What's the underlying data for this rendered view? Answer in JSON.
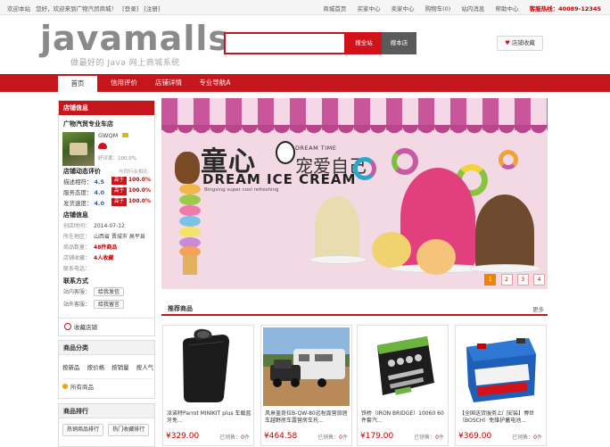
{
  "topbar": {
    "welcome": "欢迎本站",
    "greeting": "您好，欢迎来到广物汽贸商城！",
    "login": "[登录]",
    "register": "[注册]",
    "links": [
      "商城首页",
      "买家中心",
      "卖家中心",
      "购物车(0)",
      "站内消息",
      "帮助中心"
    ],
    "hotline": "客服热线：40089-12345"
  },
  "header": {
    "logo": "javamalls",
    "slogan": "做最好的 Java 网上商城系统",
    "search_input": "",
    "search_store_button": "搜全站",
    "search_shop_button": "搜本店",
    "favorite_button": "店铺收藏"
  },
  "nav": {
    "items": [
      "首页",
      "信用评价",
      "店铺详情",
      "专业导航A"
    ]
  },
  "shop": {
    "panel_title": "店铺信息",
    "name": "广物汽贸专业车店",
    "owner": "GWQM",
    "rating": "好评率：100.0%",
    "dynamic_title": "店铺动态评价",
    "compare_hint": "与同行业相比",
    "scores": [
      {
        "label": "描述相符：",
        "value": "4.5",
        "tag": "高于",
        "pct": "100.0%"
      },
      {
        "label": "服务态度：",
        "value": "4.0",
        "tag": "高于",
        "pct": "100.0%"
      },
      {
        "label": "发货速度：",
        "value": "4.0",
        "tag": "高于",
        "pct": "100.0%"
      }
    ],
    "info_title": "店铺信息",
    "info": [
      {
        "label": "创店时间：",
        "value": "2014-07-12",
        "red": false
      },
      {
        "label": "所在地区：",
        "value": "山西省 晋城市 高平县",
        "red": false
      },
      {
        "label": "商品数量：",
        "value": "48件商品",
        "red": true
      },
      {
        "label": "店铺收藏：",
        "value": "4人收藏",
        "red": true
      },
      {
        "label": "联系电话：",
        "value": "",
        "red": false
      }
    ],
    "contact_title": "联系方式",
    "contact_in": "站内客服：",
    "contact_in_btn": "给我发信",
    "contact_out": "站外客服：",
    "contact_out_btn": "给我留言",
    "collect": "收藏店铺"
  },
  "category": {
    "title": "商品分类",
    "links": [
      "按新品",
      "按价格",
      "按销量",
      "按人气"
    ],
    "all": "所有商品"
  },
  "ranking": {
    "title": "商品排行",
    "tabs": [
      "热销商品排行",
      "热门收藏排行"
    ]
  },
  "banner": {
    "big_text": "童心",
    "dream_time": "DREAM TIME",
    "sub_text": "宠爱自己",
    "en_text": "DREAM ICE CREAM",
    "tiny": "Bingsing super cool refreshing",
    "pages": [
      "1",
      "2",
      "3",
      "4"
    ],
    "active_page": 0
  },
  "recommend": {
    "title": "推荐商品",
    "more": "更多",
    "sold_label": "已销售：",
    "sold_unit": "件",
    "products": [
      {
        "name": "派诺特Parrot MINIKIT plus 车载蓝牙免...",
        "price": "¥329.00",
        "sold": "0"
      },
      {
        "name": "风景盖奇拉B-QW-80远程露营旅居车越野房车露营房车托...",
        "price": "¥464.58",
        "sold": "0"
      },
      {
        "name": "铁桥（IRON BRIDGE）10060 60件套汽...",
        "price": "¥179.00",
        "sold": "0"
      },
      {
        "name": "【全国送货服务上门安装】博世（BOSCH）免维护蓄电池...",
        "price": "¥369.00",
        "sold": "0"
      }
    ]
  }
}
